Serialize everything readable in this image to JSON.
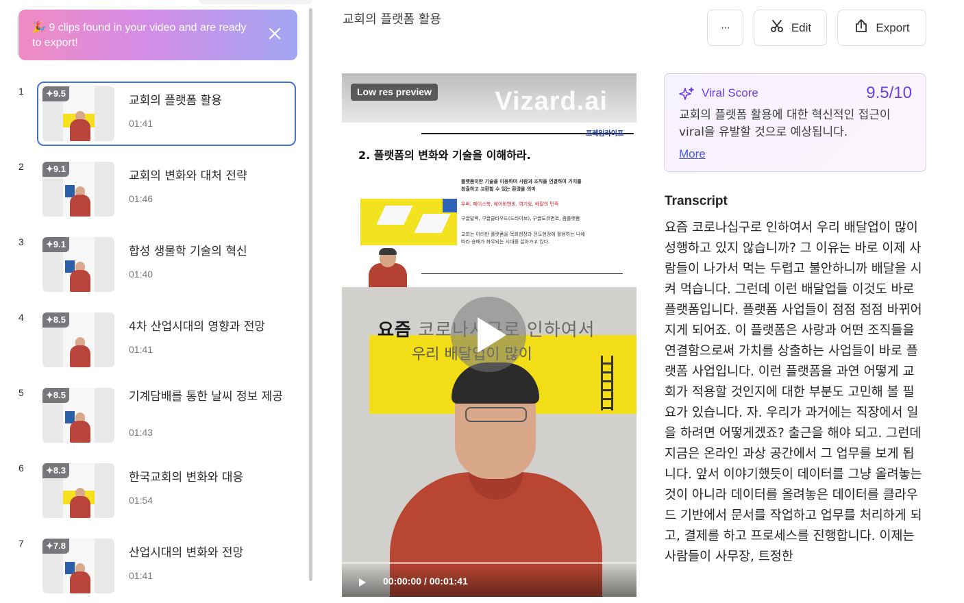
{
  "banner": {
    "text": "🎉 9 clips found in your video and are ready to export!"
  },
  "clips": [
    {
      "index": "1",
      "score": "✦9.5",
      "title": "교회의 플랫폼 활용",
      "duration": "01:41"
    },
    {
      "index": "2",
      "score": "✦9.1",
      "title": "교회의 변화와 대처 전략",
      "duration": "01:46"
    },
    {
      "index": "3",
      "score": "✦9.1",
      "title": "합성 생물학 기술의 혁신",
      "duration": "01:40"
    },
    {
      "index": "4",
      "score": "✦8.5",
      "title": "4차 산업시대의 영향과 전망",
      "duration": "01:41"
    },
    {
      "index": "5",
      "score": "✦8.5",
      "title": "기계담배를 통한 날씨 정보 제공",
      "duration": "01:43"
    },
    {
      "index": "6",
      "score": "✦8.3",
      "title": "한국교회의 변화와 대응",
      "duration": "01:54"
    },
    {
      "index": "7",
      "score": "✦7.8",
      "title": "산업시대의 변화와 전망",
      "duration": "01:41"
    }
  ],
  "header": {
    "title": "교회의 플랫폼 활용",
    "more_label": "···",
    "edit_label": "Edit",
    "export_label": "Export"
  },
  "video": {
    "badge": "Low res preview",
    "watermark": "Vizard.ai",
    "slide_tag": "프레임라이프",
    "slide_heading": "2. 플랫폼의 변화와 기술을 이해하라.",
    "slide_lines": [
      "플랫폼이란 기술을 이용하여 사람과 조직을 연결하여 가치를",
      "창출하고 교환할 수 있는 환경을 의미",
      "우버, 페이스북, 에어비앤비, 여기요, 배달의 민족",
      "구글달력, 구글클라우드(드라이브), 구글도큐먼트, 줌플랫폼",
      "교회는 이러한 플랫폼을 목회현장과 전도현장에 활용하는 나에",
      "따라 승패가 좌우되는 시대를 살아가고 있다."
    ],
    "subtitle_bold": "요즘",
    "subtitle_rest": " 코로나시구로 인하여서",
    "subtitle_line2": "우리 배달업이 많이",
    "time": "00:00:00 / 00:01:41"
  },
  "viral": {
    "label": "Viral Score",
    "score": "9.5/10",
    "description": "교회의 플랫폼 활용에 대한 혁신적인 접근이 viral을 유발할 것으로 예상됩니다.",
    "more": "More"
  },
  "transcript": {
    "title": "Transcript",
    "text": "요즘 코로나십구로 인하여서 우리 배달업이 많이 성행하고 있지 않습니까? 그 이유는 바로 이제 사람들이 나가서 먹는 두렵고 불안하니까 배달을 시켜 먹습니다. 그런데 이런 배달업들 이것도 바로 플랫폼입니다. 플랫폼 사업들이 점점 점점 바뀌어지게 되어죠. 이 플랫폼은 사랑과 어떤 조직들을 연결함으로써 가치를 상출하는 사업들이 바로 플랫폼 사업입니다. 이런 플랫폼을 과연 어떻게 교회가 적용할 것인지에 대한 부분도 고민해 볼 필요가 있습니다. 자. 우리가 과거에는 직장에서 일을 하려면 어떻게겠죠? 출근을 해야 되고. 그런데 지금은 온라인 과상 공간에서 그 업무를 보게 됩니다. 앞서 이야기했듯이 데이터를 그냥 올려놓는 것이 아니라 데이터를 올려놓은 데이터를 클라우드 기반에서 문서를 작업하고 업무를 처리하게 되고, 결제를 하고 프로세스를 진행합니다. 이제는 사람들이 사무장, 트정한"
  },
  "colors": {
    "accent": "#6b3ee6",
    "selected_border": "#3f70db",
    "link": "#4c57e6"
  }
}
